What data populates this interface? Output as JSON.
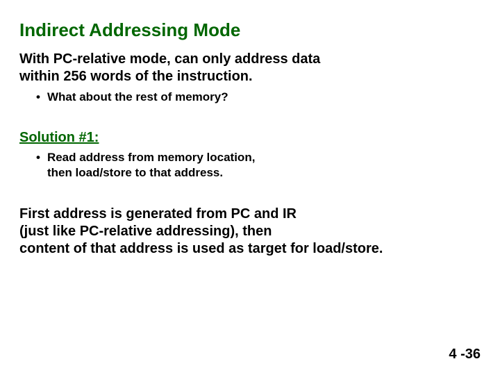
{
  "title": "Indirect Addressing Mode",
  "para1_line1": "With PC-relative mode, can only address data",
  "para1_line2": "within 256 words of the instruction.",
  "bullet1": "What about the rest of memory?",
  "solution_label": "Solution #1:",
  "bullet2_line1": "Read address from memory location,",
  "bullet2_line2": "then load/store to that address.",
  "para2_line1": "First address is generated from PC and IR",
  "para2_line2": "(just like PC-relative addressing), then",
  "para2_line3": "content of that address is used as target for load/store.",
  "page_number": "4 -36"
}
